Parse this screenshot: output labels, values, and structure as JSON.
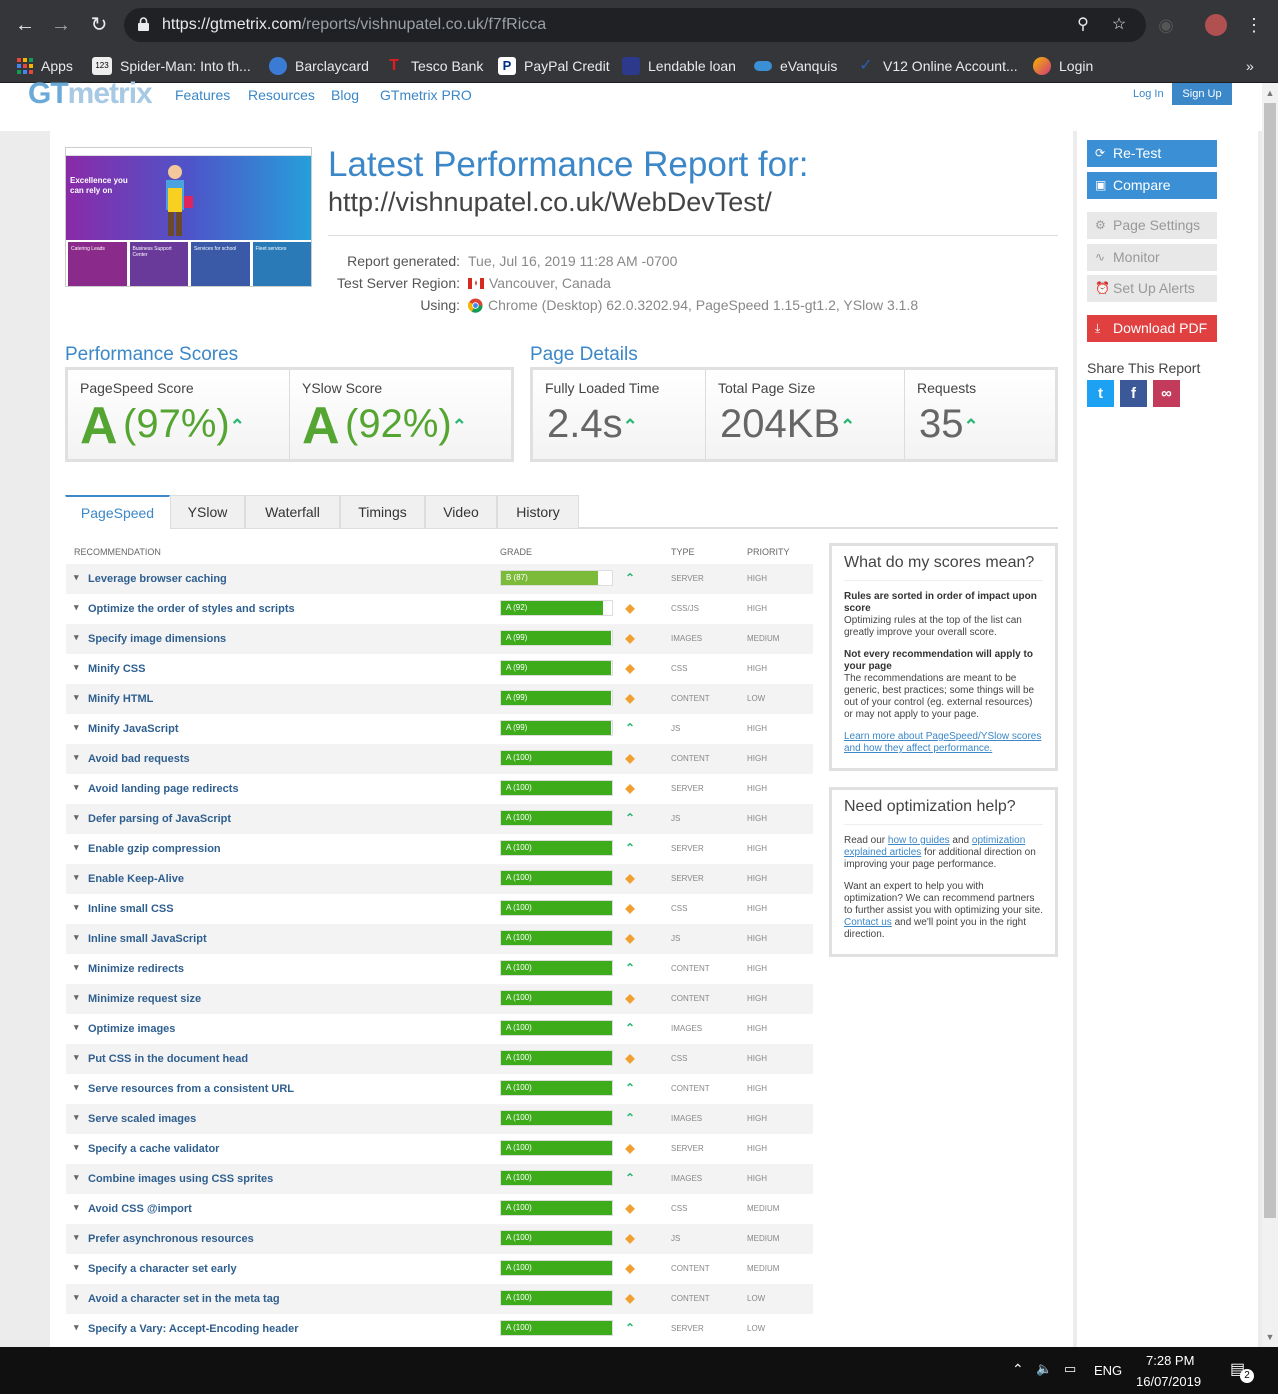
{
  "browser": {
    "url_host": "https://gtmetrix.com",
    "url_path": "/reports/vishnupatel.co.uk/f7fRicca",
    "bookmarks": [
      {
        "label": "Apps",
        "icon": "apps-grid-icon",
        "color": "#e8453c"
      },
      {
        "label": "Spider-Man: Into th...",
        "icon": "123movies-icon",
        "color": "#222222"
      },
      {
        "label": "Barclaycard",
        "icon": "barclaycard-icon",
        "color": "#3a7bd5"
      },
      {
        "label": "Tesco Bank",
        "icon": "tesco-icon",
        "color": "#e31b23"
      },
      {
        "label": "PayPal Credit",
        "icon": "paypal-icon",
        "color": "#ffffff"
      },
      {
        "label": "Lendable loan",
        "icon": "lendable-icon",
        "color": "#2d3a8c"
      },
      {
        "label": "eVanquis",
        "icon": "vanquis-icon",
        "color": "#3b8fd4"
      },
      {
        "label": "V12 Online Account...",
        "icon": "v12-icon",
        "color": "#2b5fb4"
      },
      {
        "label": "Login",
        "icon": "login-icon",
        "color": "#d23a7a"
      }
    ],
    "bookmarks_overflow": "»"
  },
  "site": {
    "logo_a": "GT",
    "logo_b": "metrix",
    "nav": [
      "Features",
      "Resources",
      "Blog",
      "GTmetrix PRO"
    ],
    "login": "Log In",
    "signup": "Sign Up"
  },
  "report": {
    "title": "Latest Performance Report for:",
    "url": "http://vishnupatel.co.uk/WebDevTest/",
    "generated_label": "Report generated:",
    "generated_value": "Tue, Jul 16, 2019 11:28 AM -0700",
    "region_label": "Test Server Region:",
    "region_value": "Vancouver, Canada",
    "using_label": "Using:",
    "using_value": "Chrome (Desktop) 62.0.3202.94, PageSpeed 1.15-gt1.2, YSlow 3.1.8",
    "thumb_hero": "Excellence you can rely on",
    "thumb_cards": [
      "Catering Leads",
      "Business Support Center",
      "Services for school",
      "Fleet services"
    ]
  },
  "scores": {
    "section_title": "Performance Scores",
    "pagespeed_label": "PageSpeed Score",
    "pagespeed_grade": "A",
    "pagespeed_pct": "(97%)",
    "yslow_label": "YSlow Score",
    "yslow_grade": "A",
    "yslow_pct": "(92%)"
  },
  "details": {
    "section_title": "Page Details",
    "loaded_label": "Fully Loaded Time",
    "loaded_value": "2.4s",
    "size_label": "Total Page Size",
    "size_value": "204KB",
    "requests_label": "Requests",
    "requests_value": "35"
  },
  "tabs": [
    "PageSpeed",
    "YSlow",
    "Waterfall",
    "Timings",
    "Video",
    "History"
  ],
  "table_headers": {
    "recommendation": "RECOMMENDATION",
    "grade": "GRADE",
    "type": "TYPE",
    "priority": "PRIORITY"
  },
  "recommendations": [
    {
      "name": "Leverage browser caching",
      "grade": "B (87)",
      "score": 87,
      "trend": "up",
      "type": "SERVER",
      "priority": "HIGH"
    },
    {
      "name": "Optimize the order of styles and scripts",
      "grade": "A (92)",
      "score": 92,
      "trend": "diamond",
      "type": "CSS/JS",
      "priority": "HIGH"
    },
    {
      "name": "Specify image dimensions",
      "grade": "A (99)",
      "score": 99,
      "trend": "diamond",
      "type": "IMAGES",
      "priority": "MEDIUM"
    },
    {
      "name": "Minify CSS",
      "grade": "A (99)",
      "score": 99,
      "trend": "diamond",
      "type": "CSS",
      "priority": "HIGH"
    },
    {
      "name": "Minify HTML",
      "grade": "A (99)",
      "score": 99,
      "trend": "diamond",
      "type": "CONTENT",
      "priority": "LOW"
    },
    {
      "name": "Minify JavaScript",
      "grade": "A (99)",
      "score": 99,
      "trend": "up",
      "type": "JS",
      "priority": "HIGH"
    },
    {
      "name": "Avoid bad requests",
      "grade": "A (100)",
      "score": 100,
      "trend": "diamond",
      "type": "CONTENT",
      "priority": "HIGH"
    },
    {
      "name": "Avoid landing page redirects",
      "grade": "A (100)",
      "score": 100,
      "trend": "diamond",
      "type": "SERVER",
      "priority": "HIGH"
    },
    {
      "name": "Defer parsing of JavaScript",
      "grade": "A (100)",
      "score": 100,
      "trend": "up",
      "type": "JS",
      "priority": "HIGH"
    },
    {
      "name": "Enable gzip compression",
      "grade": "A (100)",
      "score": 100,
      "trend": "up",
      "type": "SERVER",
      "priority": "HIGH"
    },
    {
      "name": "Enable Keep-Alive",
      "grade": "A (100)",
      "score": 100,
      "trend": "diamond",
      "type": "SERVER",
      "priority": "HIGH"
    },
    {
      "name": "Inline small CSS",
      "grade": "A (100)",
      "score": 100,
      "trend": "diamond",
      "type": "CSS",
      "priority": "HIGH"
    },
    {
      "name": "Inline small JavaScript",
      "grade": "A (100)",
      "score": 100,
      "trend": "diamond",
      "type": "JS",
      "priority": "HIGH"
    },
    {
      "name": "Minimize redirects",
      "grade": "A (100)",
      "score": 100,
      "trend": "up",
      "type": "CONTENT",
      "priority": "HIGH"
    },
    {
      "name": "Minimize request size",
      "grade": "A (100)",
      "score": 100,
      "trend": "diamond",
      "type": "CONTENT",
      "priority": "HIGH"
    },
    {
      "name": "Optimize images",
      "grade": "A (100)",
      "score": 100,
      "trend": "up",
      "type": "IMAGES",
      "priority": "HIGH"
    },
    {
      "name": "Put CSS in the document head",
      "grade": "A (100)",
      "score": 100,
      "trend": "diamond",
      "type": "CSS",
      "priority": "HIGH"
    },
    {
      "name": "Serve resources from a consistent URL",
      "grade": "A (100)",
      "score": 100,
      "trend": "up",
      "type": "CONTENT",
      "priority": "HIGH"
    },
    {
      "name": "Serve scaled images",
      "grade": "A (100)",
      "score": 100,
      "trend": "up",
      "type": "IMAGES",
      "priority": "HIGH"
    },
    {
      "name": "Specify a cache validator",
      "grade": "A (100)",
      "score": 100,
      "trend": "diamond",
      "type": "SERVER",
      "priority": "HIGH"
    },
    {
      "name": "Combine images using CSS sprites",
      "grade": "A (100)",
      "score": 100,
      "trend": "up",
      "type": "IMAGES",
      "priority": "HIGH"
    },
    {
      "name": "Avoid CSS @import",
      "grade": "A (100)",
      "score": 100,
      "trend": "diamond",
      "type": "CSS",
      "priority": "MEDIUM"
    },
    {
      "name": "Prefer asynchronous resources",
      "grade": "A (100)",
      "score": 100,
      "trend": "diamond",
      "type": "JS",
      "priority": "MEDIUM"
    },
    {
      "name": "Specify a character set early",
      "grade": "A (100)",
      "score": 100,
      "trend": "diamond",
      "type": "CONTENT",
      "priority": "MEDIUM"
    },
    {
      "name": "Avoid a character set in the meta tag",
      "grade": "A (100)",
      "score": 100,
      "trend": "diamond",
      "type": "CONTENT",
      "priority": "LOW"
    },
    {
      "name": "Specify a Vary: Accept-Encoding header",
      "grade": "A (100)",
      "score": 100,
      "trend": "up",
      "type": "SERVER",
      "priority": "LOW"
    }
  ],
  "info_scores": {
    "title": "What do my scores mean?",
    "b1": "Rules are sorted in order of impact upon score",
    "p1": "Optimizing rules at the top of the list can greatly improve your overall score.",
    "b2": "Not every recommendation will apply to your page",
    "p2": "The recommendations are meant to be generic, best practices; some things will be out of your control (eg. external resources) or may not apply to your page.",
    "link": "Learn more about PageSpeed/YSlow scores and how they affect performance."
  },
  "info_help": {
    "title": "Need optimization help?",
    "p1_a": "Read our ",
    "p1_link1": "how to guides",
    "p1_b": " and ",
    "p1_link2": "optimization explained articles",
    "p1_c": " for additional direction on improving your page performance.",
    "p2_a": "Want an expert to help you with optimization? We can recommend partners to further assist you with optimizing your site. ",
    "p2_link": "Contact us",
    "p2_b": " and we'll point you in the right direction."
  },
  "sidebar": {
    "retest": "Re-Test",
    "compare": "Compare",
    "page_settings": "Page Settings",
    "monitor": "Monitor",
    "alerts": "Set Up Alerts",
    "download_pdf": "Download PDF",
    "share_title": "Share This Report"
  },
  "taskbar": {
    "lang": "ENG",
    "time": "7:28 PM",
    "date": "16/07/2019",
    "notifications": "2"
  }
}
